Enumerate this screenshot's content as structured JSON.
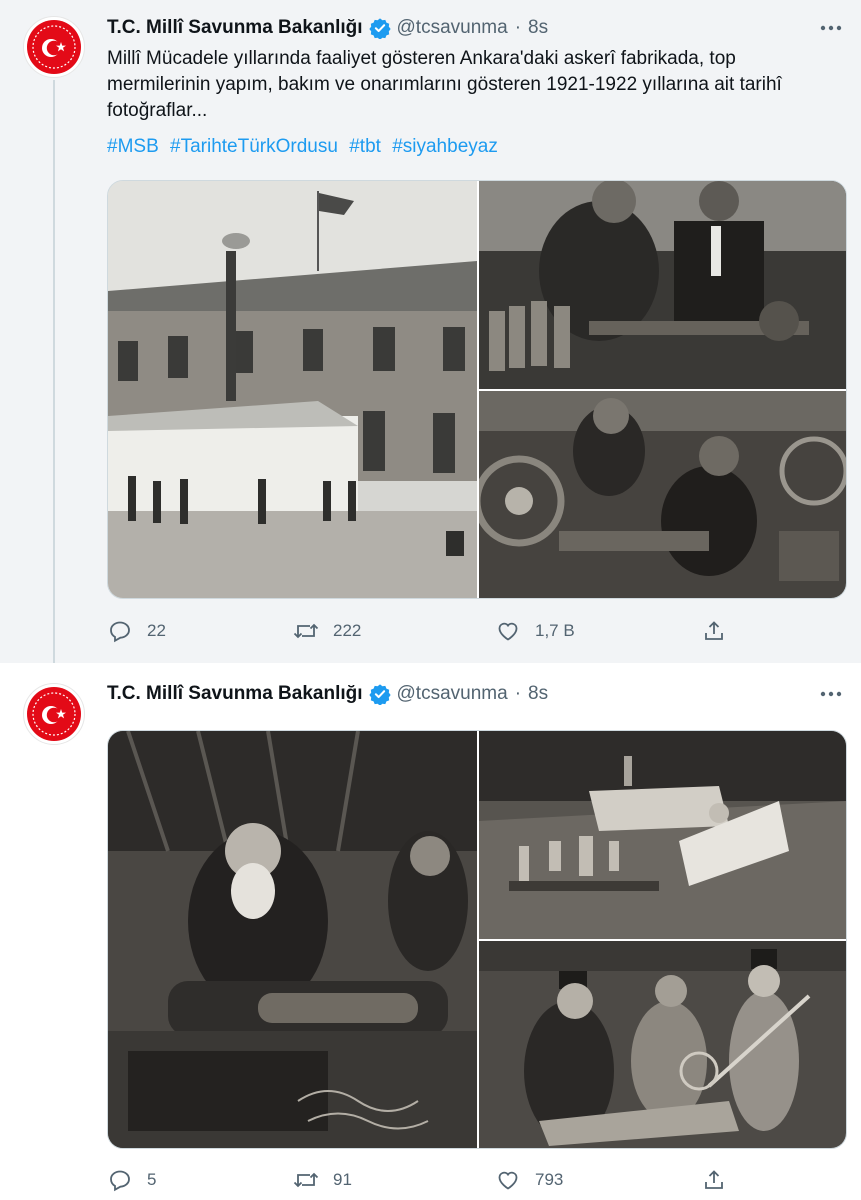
{
  "tweets": [
    {
      "author": "T.C. Millî Savunma Bakanlığı",
      "handle": "@tcsavunma",
      "separator": "·",
      "time": "8s",
      "text": "Millî Mücadele yıllarında faaliyet gösteren Ankara'daki askerî fabrikada, top mermilerinin yapım, bakım ve onarımlarını gösteren 1921-1922 yıllarına ait tarihî fotoğraflar...",
      "hashtags": [
        "#MSB",
        "#TarihteTürkOrdusu",
        "#tbt",
        "#siyahbeyaz"
      ],
      "stats": {
        "replies": "22",
        "retweets": "222",
        "likes": "1,7 B"
      }
    },
    {
      "author": "T.C. Millî Savunma Bakanlığı",
      "handle": "@tcsavunma",
      "separator": "·",
      "time": "8s",
      "stats": {
        "replies": "5",
        "retweets": "91",
        "likes": "793"
      }
    }
  ],
  "icons": {
    "verified": "verified-badge-icon",
    "more": "more-dots-icon",
    "reply": "reply-icon",
    "retweet": "retweet-icon",
    "like": "like-icon",
    "share": "share-icon"
  },
  "colors": {
    "accent": "#1d9bf0",
    "secondary_text": "#536471",
    "primary_text": "#0f1419",
    "selected_background": "#f2f4f6",
    "logo_red": "#e30a17"
  }
}
